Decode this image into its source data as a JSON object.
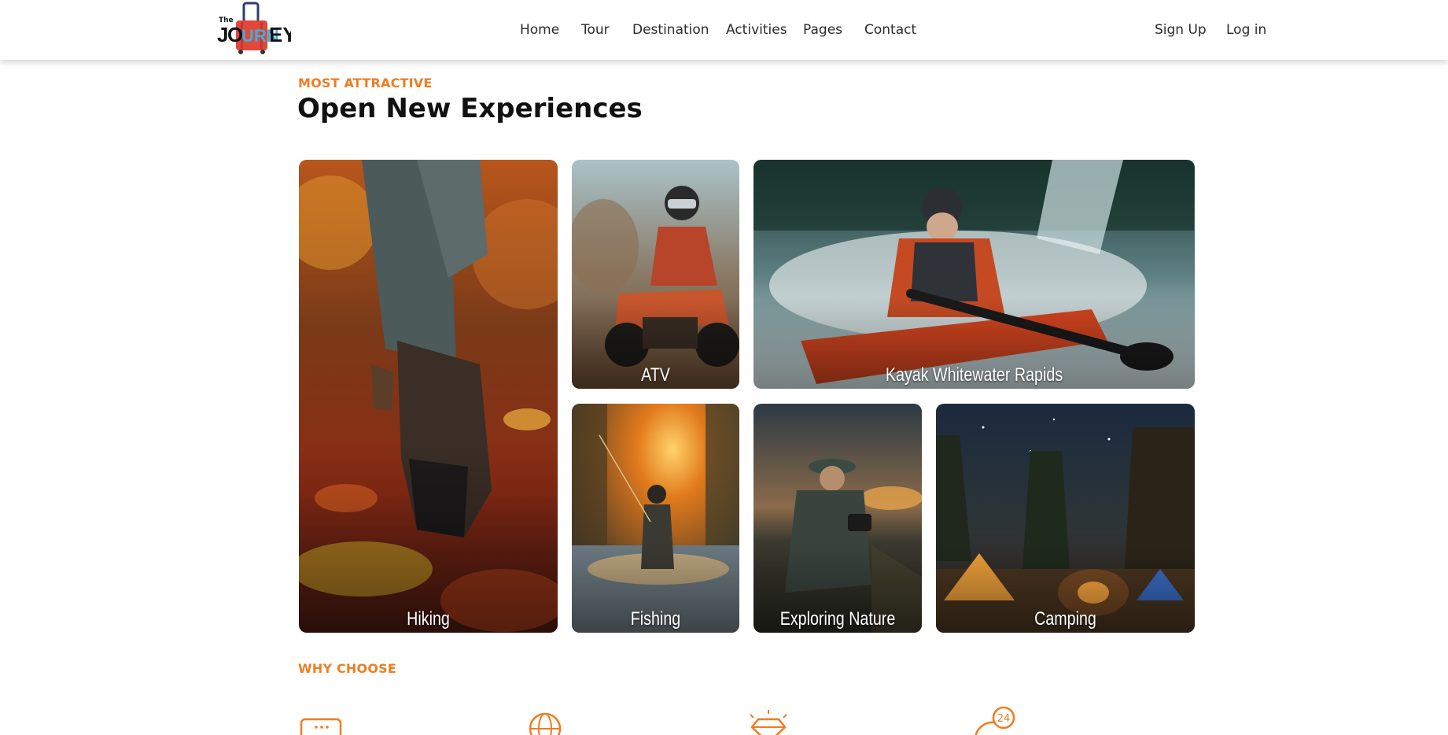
{
  "header": {
    "logo": {
      "small_text": "The",
      "brand_text": "JOURNEY"
    },
    "nav": [
      {
        "label": "Home"
      },
      {
        "label": "Tour"
      },
      {
        "label": "Destination"
      },
      {
        "label": "Activities"
      },
      {
        "label": "Pages"
      },
      {
        "label": "Contact"
      }
    ],
    "auth": {
      "signup": "Sign Up",
      "login": "Log in"
    }
  },
  "experiences": {
    "eyebrow": "MOST ATTRACTIVE",
    "title": "Open New Experiences",
    "cards": [
      {
        "label": "Hiking"
      },
      {
        "label": "ATV"
      },
      {
        "label": "Kayak Whitewater Rapids"
      },
      {
        "label": "Fishing"
      },
      {
        "label": "Exploring Nature"
      },
      {
        "label": "Camping"
      }
    ]
  },
  "why_choose": {
    "eyebrow": "WHY CHOOSE",
    "icons": [
      "ticket-icon",
      "globe-icon",
      "diamond-badge-icon",
      "support-24-icon"
    ],
    "support_icon_text": "24"
  },
  "colors": {
    "accent": "#ef7d22",
    "text": "#111111",
    "nav_text": "#2b2b2b"
  }
}
